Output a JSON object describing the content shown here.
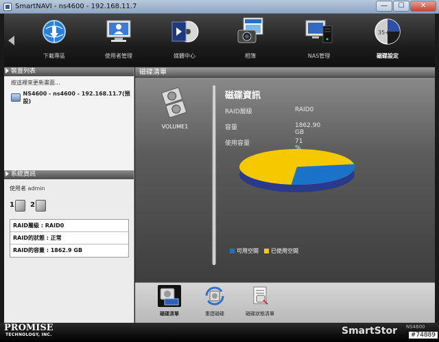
{
  "window": {
    "title": "SmartNAVI - ns4600 - 192.168.11.7",
    "minimize": "—",
    "maximize": "☐",
    "close": "✕"
  },
  "toolbar": {
    "items": [
      {
        "label": "下載專區",
        "icon": "download-globe-icon"
      },
      {
        "label": "使用者管理",
        "icon": "user-monitor-icon"
      },
      {
        "label": "媒體中心",
        "icon": "media-disc-icon"
      },
      {
        "label": "相簿",
        "icon": "album-camera-icon"
      },
      {
        "label": "NAS管理",
        "icon": "nas-monitor-icon"
      },
      {
        "label": "磁碟設定",
        "icon": "disk-pie-icon"
      }
    ],
    "active_index": 5,
    "disk_icon_text": "35+"
  },
  "device_panel": {
    "title": "裝置列表",
    "hint": "按這裡來更新畫面...",
    "device": "NS4600 - ns4600 - 192.168.11.7(預設)"
  },
  "system_panel": {
    "title": "系統資訊",
    "user": "使用者 admin",
    "disks": [
      "1",
      "2"
    ],
    "rows": [
      "RAID層級 : RAID0",
      "RAID的狀態 : 正常",
      "RAID的容量 : 1862.9 GB"
    ]
  },
  "disk_list": {
    "title": "磁碟清單",
    "volume_label": "VOLUME1"
  },
  "disk_info": {
    "title": "磁碟資訊",
    "raid_level_label": "RAID層級",
    "raid_level_value": "RAID0",
    "capacity_label": "容量",
    "capacity_value": "1862.90 GB",
    "used_label": "使用容量",
    "used_value": "71 %",
    "used_fraction": 0.71,
    "colors": {
      "free": "#1a73c9",
      "used": "#f5c800",
      "rim_used": "#2a3a8a"
    },
    "legend_free": "可用空間",
    "legend_used": "已使用空間"
  },
  "bottom_tools": [
    {
      "label": "磁碟清單",
      "icon": "disk-list-icon"
    },
    {
      "label": "重建磁碟",
      "icon": "rebuild-disk-icon"
    },
    {
      "label": "磁碟狀態清單",
      "icon": "disk-status-icon"
    }
  ],
  "footer": {
    "brand": "PROMISE",
    "brand_sub": "TECHNOLOGY, INC.",
    "product": "SmartStor",
    "model": "NS4600",
    "tag": "#74889"
  }
}
